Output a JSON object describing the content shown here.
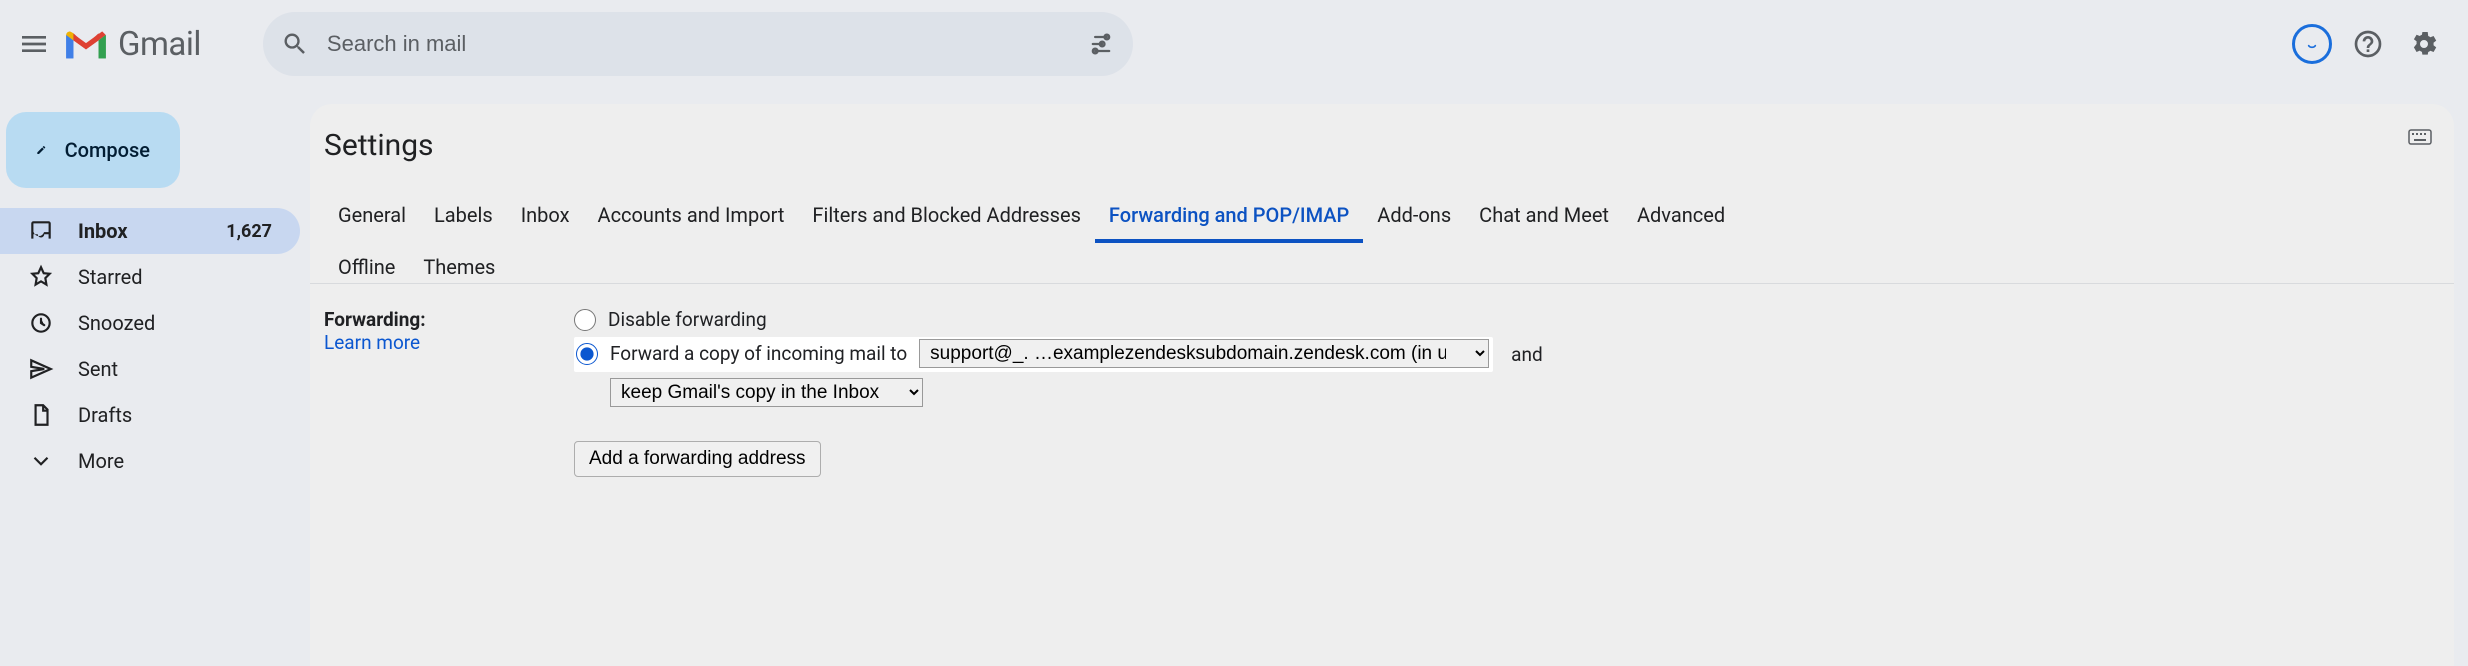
{
  "header": {
    "brand": "Gmail",
    "search_placeholder": "Search in mail"
  },
  "compose": {
    "label": "Compose"
  },
  "sidebar": {
    "items": [
      {
        "label": "Inbox",
        "count": "1,627"
      },
      {
        "label": "Starred"
      },
      {
        "label": "Snoozed"
      },
      {
        "label": "Sent"
      },
      {
        "label": "Drafts"
      },
      {
        "label": "More"
      }
    ]
  },
  "page_title": "Settings",
  "tabs": {
    "row1": [
      "General",
      "Labels",
      "Inbox",
      "Accounts and Import",
      "Filters and Blocked Addresses",
      "Forwarding and POP/IMAP",
      "Add-ons",
      "Chat and Meet",
      "Advanced"
    ],
    "row2": [
      "Offline",
      "Themes"
    ],
    "active": "Forwarding and POP/IMAP"
  },
  "forwarding": {
    "section_label": "Forwarding:",
    "learn_more": "Learn more",
    "disable_label": "Disable forwarding",
    "forward_label_prefix": "Forward a copy of incoming mail to",
    "address_selected": "support@_. …examplezendesksubdomain.zendesk.com (in use)",
    "and_word": "and",
    "keep_selected": "keep Gmail's copy in the Inbox",
    "add_button": "Add a forwarding address"
  }
}
